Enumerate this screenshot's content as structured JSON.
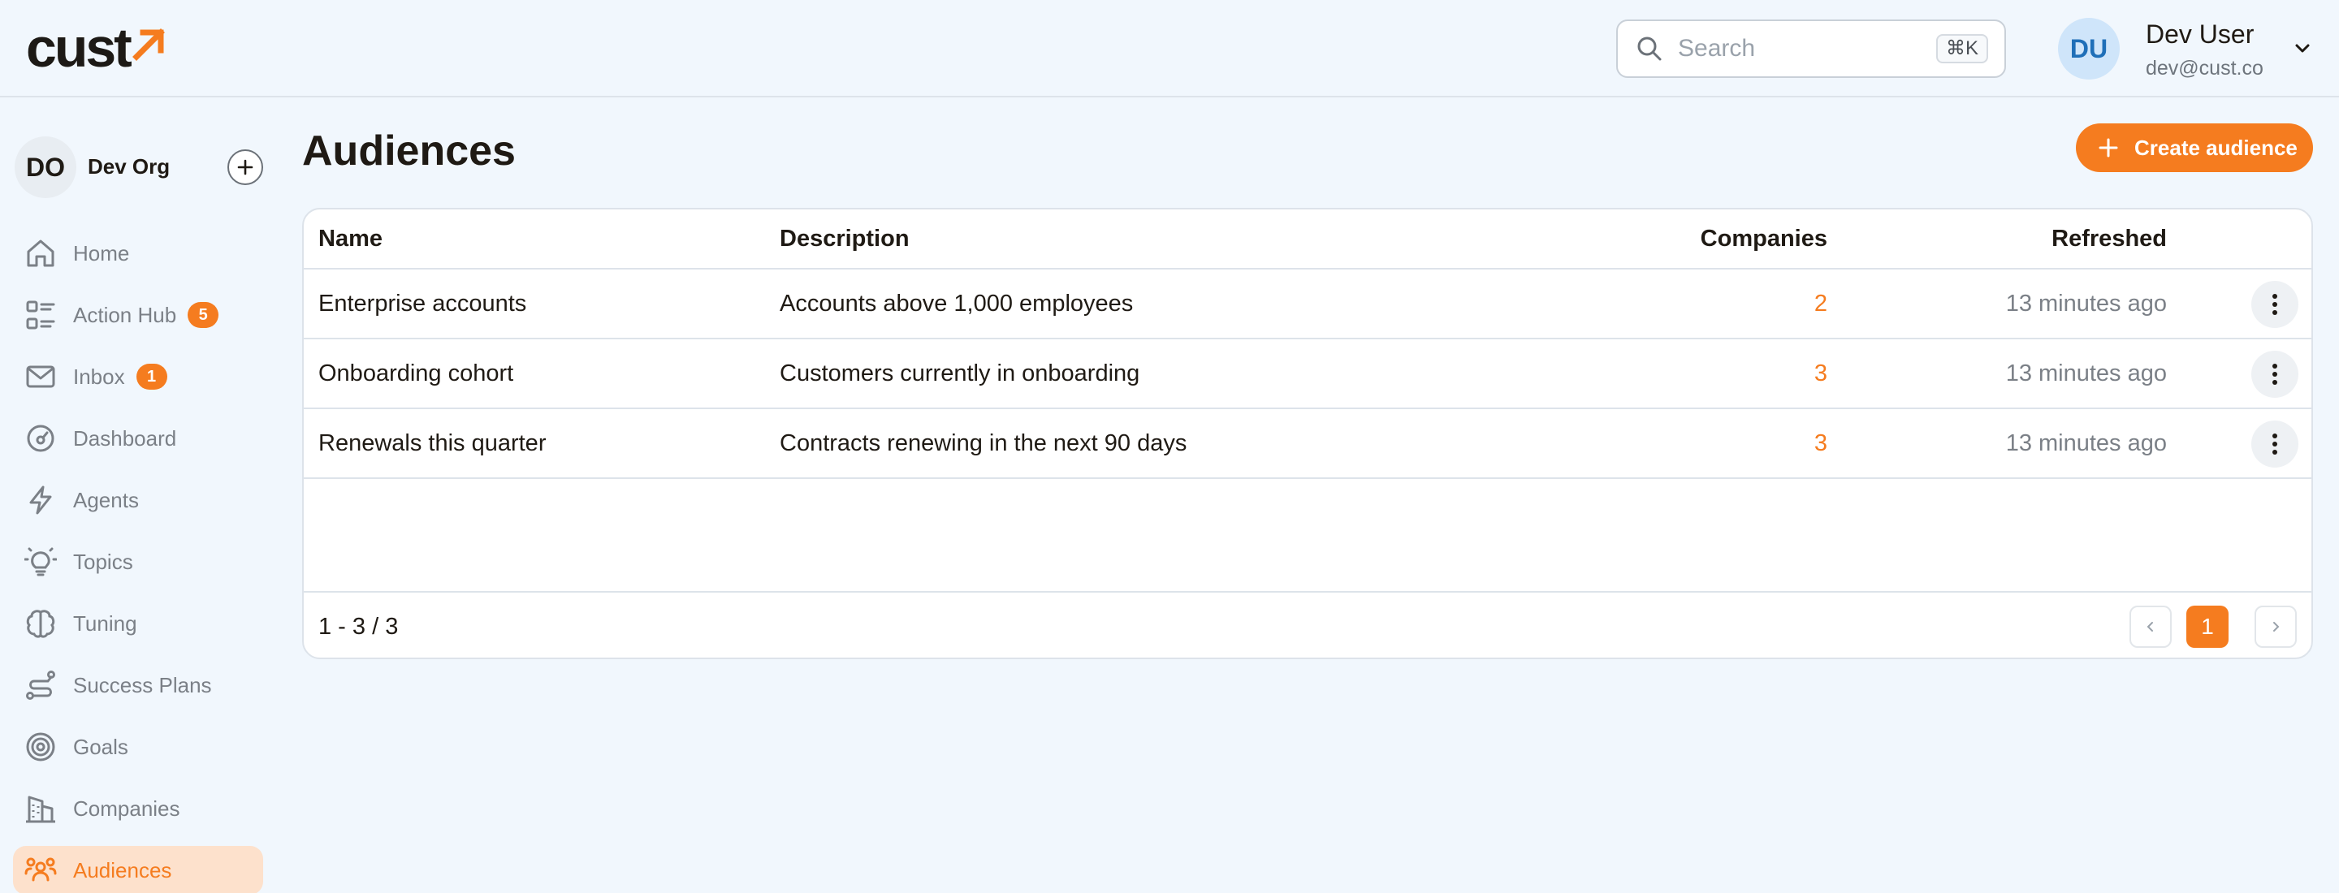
{
  "header": {
    "logo_text": "cust",
    "search": {
      "placeholder": "Search",
      "shortcut": "⌘K"
    },
    "user": {
      "initials": "DU",
      "name": "Dev User",
      "email": "dev@cust.co"
    }
  },
  "sidebar": {
    "org": {
      "initials": "DO",
      "name": "Dev Org"
    },
    "items": [
      {
        "label": "Home",
        "icon": "home-icon"
      },
      {
        "label": "Action Hub",
        "icon": "action-list-icon",
        "badge": "5"
      },
      {
        "label": "Inbox",
        "icon": "mail-icon",
        "badge": "1"
      },
      {
        "label": "Dashboard",
        "icon": "gauge-icon"
      },
      {
        "label": "Agents",
        "icon": "bolt-icon"
      },
      {
        "label": "Topics",
        "icon": "lightbulb-icon"
      },
      {
        "label": "Tuning",
        "icon": "brain-icon"
      },
      {
        "label": "Success Plans",
        "icon": "route-icon"
      },
      {
        "label": "Goals",
        "icon": "target-icon"
      },
      {
        "label": "Companies",
        "icon": "building-icon"
      },
      {
        "label": "Audiences",
        "icon": "users-icon",
        "active": true
      }
    ]
  },
  "main": {
    "title": "Audiences",
    "create_label": "Create audience",
    "table": {
      "columns": [
        "Name",
        "Description",
        "Companies",
        "Refreshed"
      ],
      "rows": [
        {
          "name": "Enterprise accounts",
          "description": "Accounts above 1,000 employees",
          "companies": "2",
          "refreshed": "13 minutes ago"
        },
        {
          "name": "Onboarding cohort",
          "description": "Customers currently in onboarding",
          "companies": "3",
          "refreshed": "13 minutes ago"
        },
        {
          "name": "Renewals this quarter",
          "description": "Contracts renewing in the next 90 days",
          "companies": "3",
          "refreshed": "13 minutes ago"
        }
      ],
      "pagination": {
        "range": "1 - 3 / 3",
        "current_page": "1"
      }
    }
  },
  "colors": {
    "accent": "#f57c1f",
    "background": "#f1f7fd",
    "avatar_bg": "#cfe5fa"
  }
}
